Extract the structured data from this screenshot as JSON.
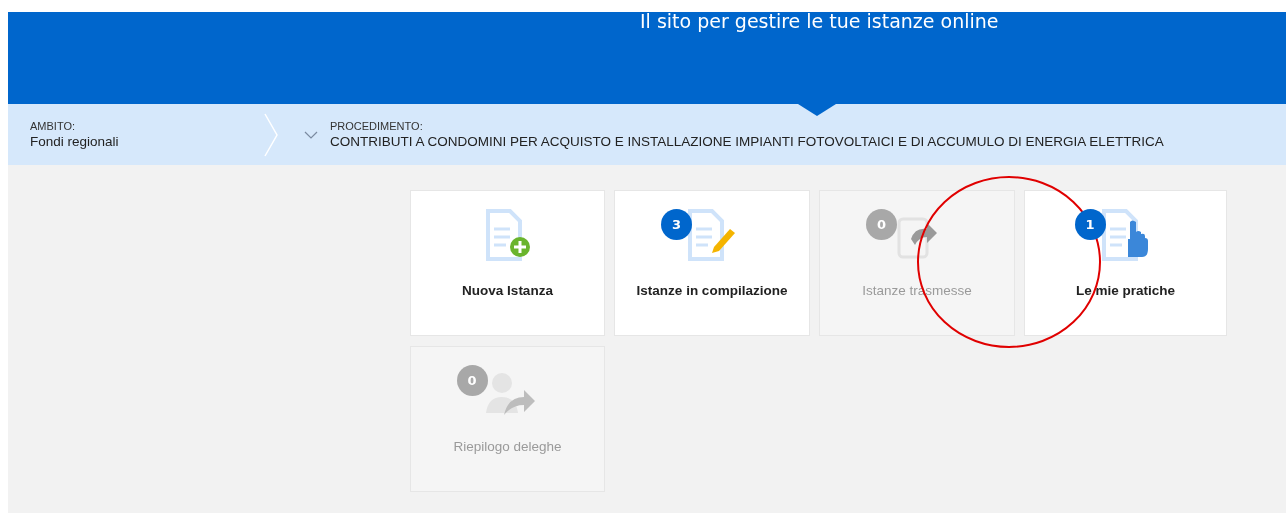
{
  "header": {
    "title": "Il sito per gestire le tue istanze online"
  },
  "breadcrumb": {
    "items": [
      {
        "label": "AMBITO:",
        "value": "Fondi regionali"
      },
      {
        "label": "PROCEDIMENTO:",
        "value": "CONTRIBUTI A CONDOMINI PER ACQUISTO E INSTALLAZIONE IMPIANTI FOTOVOLTAICI E DI ACCUMULO DI ENERGIA ELETTRICA"
      }
    ]
  },
  "cards": [
    {
      "kind": "new",
      "title": "Nuova Istanza",
      "disabled": false
    },
    {
      "kind": "edit",
      "title": "Istanze in compilazione",
      "badge": "3",
      "disabled": false
    },
    {
      "kind": "sent",
      "title": "Istanze trasmesse",
      "badge": "0",
      "disabled": true
    },
    {
      "kind": "hand",
      "title": "Le mie pratiche",
      "badge": "1",
      "disabled": false
    },
    {
      "kind": "delegate",
      "title": "Riepilogo deleghe",
      "badge": "0",
      "disabled": true
    }
  ]
}
